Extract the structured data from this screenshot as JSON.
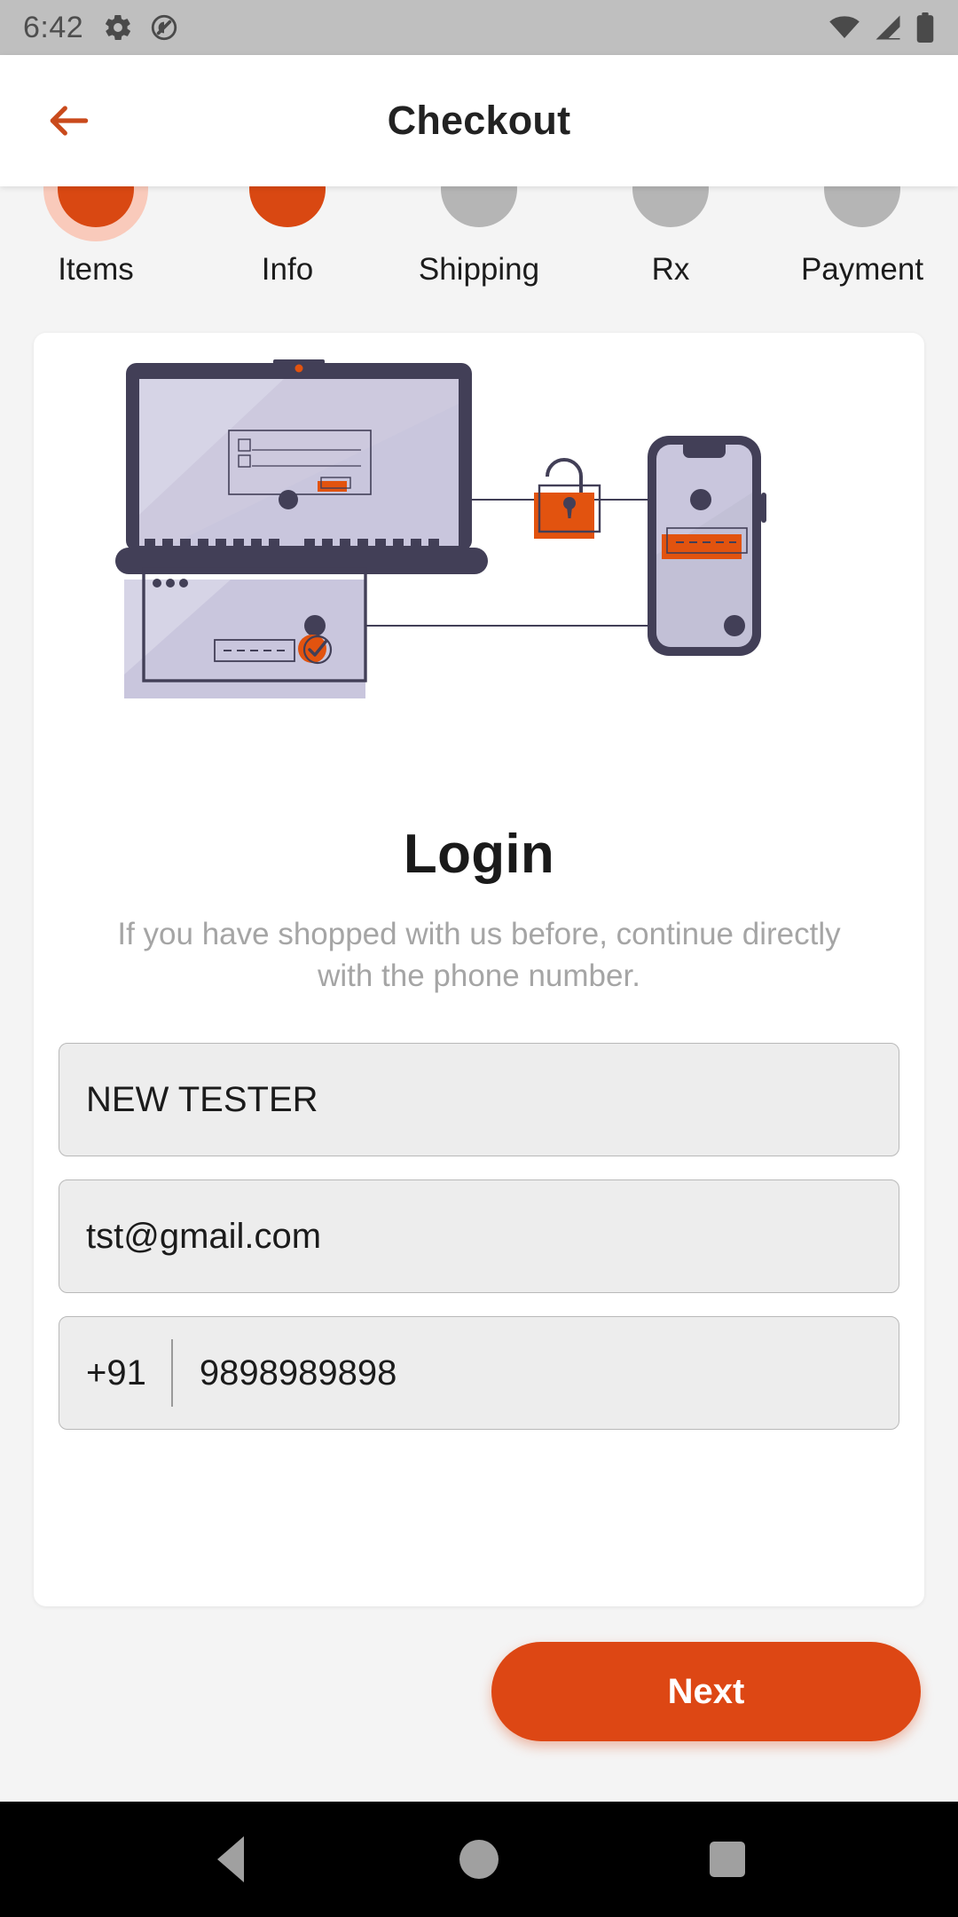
{
  "status_bar": {
    "time": "6:42",
    "left_icons": [
      "gear-icon",
      "do-not-disturb-icon"
    ],
    "right_icons": [
      "wifi-icon",
      "cellular-signal-icon",
      "battery-icon"
    ]
  },
  "app_bar": {
    "back_label": "back-arrow-icon",
    "title": "Checkout"
  },
  "stepper": {
    "steps": [
      {
        "label": "Items",
        "state": "done"
      },
      {
        "label": "Info",
        "state": "active"
      },
      {
        "label": "Shipping",
        "state": "idle"
      },
      {
        "label": "Rx",
        "state": "idle"
      },
      {
        "label": "Payment",
        "state": "idle"
      }
    ]
  },
  "login_card": {
    "illustration": "secure-login-devices-illustration",
    "title": "Login",
    "subtitle": "If you have shopped with us before, continue directly with the phone number.",
    "fields": {
      "name": {
        "value": "NEW TESTER",
        "placeholder": "Name"
      },
      "email": {
        "value": "tst@gmail.com",
        "placeholder": "Email"
      },
      "phone": {
        "country_code": "+91",
        "value": "9898989898",
        "placeholder": "Phone number"
      }
    }
  },
  "actions": {
    "next_label": "Next"
  },
  "nav_bar": {
    "back": "nav-back-icon",
    "home": "nav-home-icon",
    "recents": "nav-recents-icon"
  },
  "colors": {
    "accent": "#dd4714",
    "accent_dark": "#d94812",
    "halo": "#f9cabb",
    "idle_step": "#b5b5b5",
    "page_bg": "#f4f4f4",
    "card_bg": "#ffffff",
    "field_bg": "#ededed",
    "field_border": "#b9b9b9",
    "muted_text": "#a5a5a5",
    "illus_dark": "#423f57",
    "illus_screen": "#c9c6dd"
  }
}
